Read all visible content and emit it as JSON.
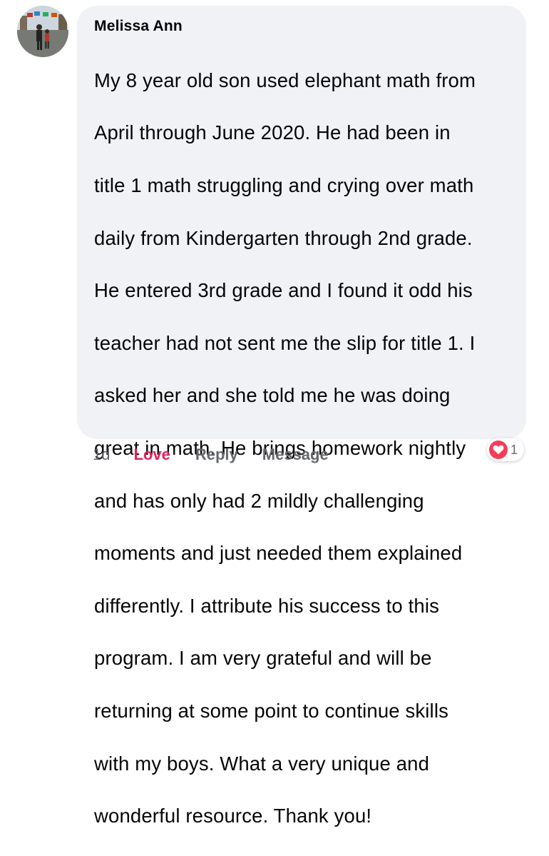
{
  "comment": {
    "author": "Melissa Ann",
    "lines": [
      "My 8 year old son used elephant math from",
      "April through June 2020. He had been in",
      "title 1 math struggling and crying over math",
      "daily from Kindergarten through 2nd grade.",
      "He entered 3rd grade and I found it odd his",
      "teacher had not sent me the slip for title 1. I",
      "asked her and she told me he was doing",
      "great in math. He brings homework nightly",
      "and has only had 2 mildly challenging",
      "moments and just needed them explained",
      "differently.  I attribute his success to this",
      "program. I am very grateful and will be",
      "returning at some point to continue skills",
      "with my boys. What a very unique and",
      "wonderful resource. Thank you!"
    ]
  },
  "actions": {
    "time": "1d",
    "love": "Love",
    "reply": "Reply",
    "message": "Message"
  },
  "reactions": {
    "icon": "heart-icon",
    "count": "1",
    "color": "#f33e58"
  },
  "colors": {
    "bubble": "#f0f2f5",
    "love_active": "#e0245e",
    "muted_text": "#65676b"
  }
}
